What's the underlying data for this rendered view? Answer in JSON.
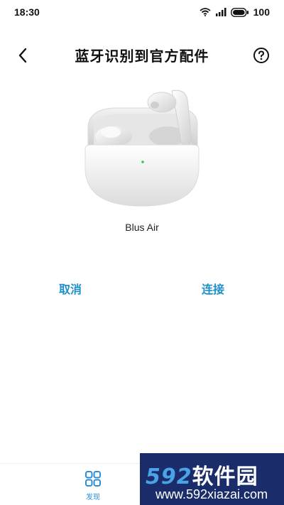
{
  "status_bar": {
    "time": "18:30",
    "battery_level": "100",
    "icons": [
      "wifi-icon",
      "signal-icon",
      "battery-icon"
    ]
  },
  "header": {
    "title": "蓝牙识别到官方配件",
    "back_icon": "chevron-left-icon",
    "help_icon": "question-circle-icon"
  },
  "device": {
    "name": "Blus Air"
  },
  "actions": {
    "cancel_label": "取消",
    "connect_label": "连接"
  },
  "bottom_nav": {
    "items": [
      {
        "label": "发现",
        "icon": "grid-icon"
      },
      {
        "label": "",
        "icon": "scan-icon"
      }
    ]
  },
  "watermark": {
    "brand_number": "592",
    "brand_text": "软件园",
    "url": "www.592xiazai.com"
  },
  "colors": {
    "accent": "#1e90c8",
    "nav_active": "#2b8fd8",
    "watermark_bg": "#1a2d6a"
  }
}
